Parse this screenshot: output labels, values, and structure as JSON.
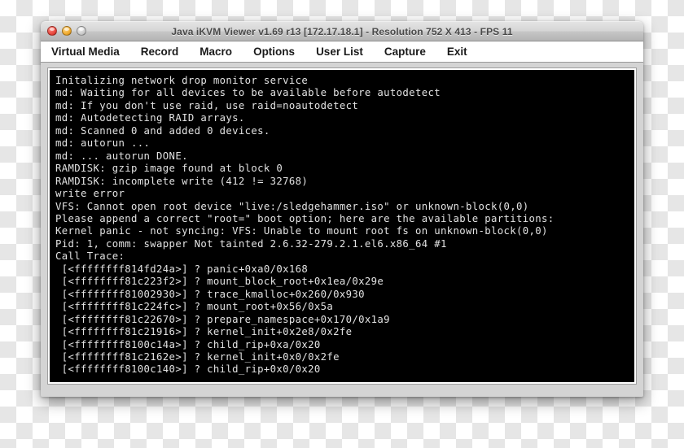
{
  "window": {
    "title": "Java iKVM Viewer v1.69 r13 [172.17.18.1]  - Resolution 752 X 413 - FPS 11",
    "controls": {
      "close_label": "",
      "minimize_label": "",
      "zoom_label": ""
    }
  },
  "menubar": {
    "items": [
      {
        "label": "Virtual Media"
      },
      {
        "label": "Record"
      },
      {
        "label": "Macro"
      },
      {
        "label": "Options"
      },
      {
        "label": "User List"
      },
      {
        "label": "Capture"
      },
      {
        "label": "Exit"
      }
    ]
  },
  "terminal": {
    "lines": [
      "Initalizing network drop monitor service",
      "md: Waiting for all devices to be available before autodetect",
      "md: If you don't use raid, use raid=noautodetect",
      "md: Autodetecting RAID arrays.",
      "md: Scanned 0 and added 0 devices.",
      "md: autorun ...",
      "md: ... autorun DONE.",
      "RAMDISK: gzip image found at block 0",
      "RAMDISK: incomplete write (412 != 32768)",
      "write error",
      "VFS: Cannot open root device \"live:/sledgehammer.iso\" or unknown-block(0,0)",
      "Please append a correct \"root=\" boot option; here are the available partitions:",
      "Kernel panic - not syncing: VFS: Unable to mount root fs on unknown-block(0,0)",
      "Pid: 1, comm: swapper Not tainted 2.6.32-279.2.1.el6.x86_64 #1",
      "Call Trace:",
      " [<ffffffff814fd24a>] ? panic+0xa0/0x168",
      " [<ffffffff81c223f2>] ? mount_block_root+0x1ea/0x29e",
      " [<ffffffff81002930>] ? trace_kmalloc+0x260/0x930",
      " [<ffffffff81c224fc>] ? mount_root+0x56/0x5a",
      " [<ffffffff81c22670>] ? prepare_namespace+0x170/0x1a9",
      " [<ffffffff81c21916>] ? kernel_init+0x2e8/0x2fe",
      " [<ffffffff8100c14a>] ? child_rip+0xa/0x20",
      " [<ffffffff81c2162e>] ? kernel_init+0x0/0x2fe",
      " [<ffffffff8100c140>] ? child_rip+0x0/0x20"
    ],
    "cursor": "_"
  }
}
